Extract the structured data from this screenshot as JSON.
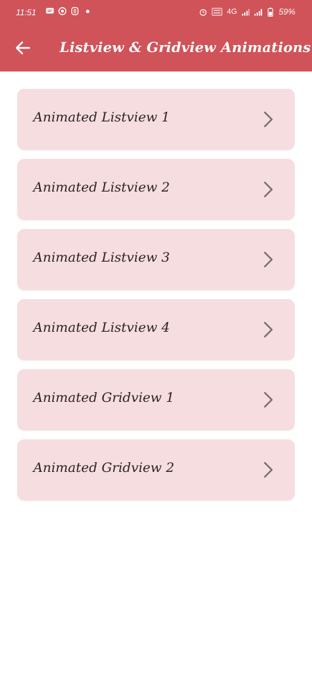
{
  "status_bar": {
    "time": "11:51",
    "network": "4G",
    "battery": "59%"
  },
  "app_bar": {
    "title": "Listview & Gridview Animations",
    "back_icon": "arrow-left-icon"
  },
  "items": [
    {
      "label": "Animated Listview 1"
    },
    {
      "label": "Animated Listview 2"
    },
    {
      "label": "Animated Listview 3"
    },
    {
      "label": "Animated Listview 4"
    },
    {
      "label": "Animated Gridview 1"
    },
    {
      "label": "Animated Gridview 2"
    }
  ],
  "colors": {
    "app_bar": "#cf5358",
    "card": "#f6dde0",
    "text": "#2b2224",
    "chevron": "#7a7072"
  }
}
